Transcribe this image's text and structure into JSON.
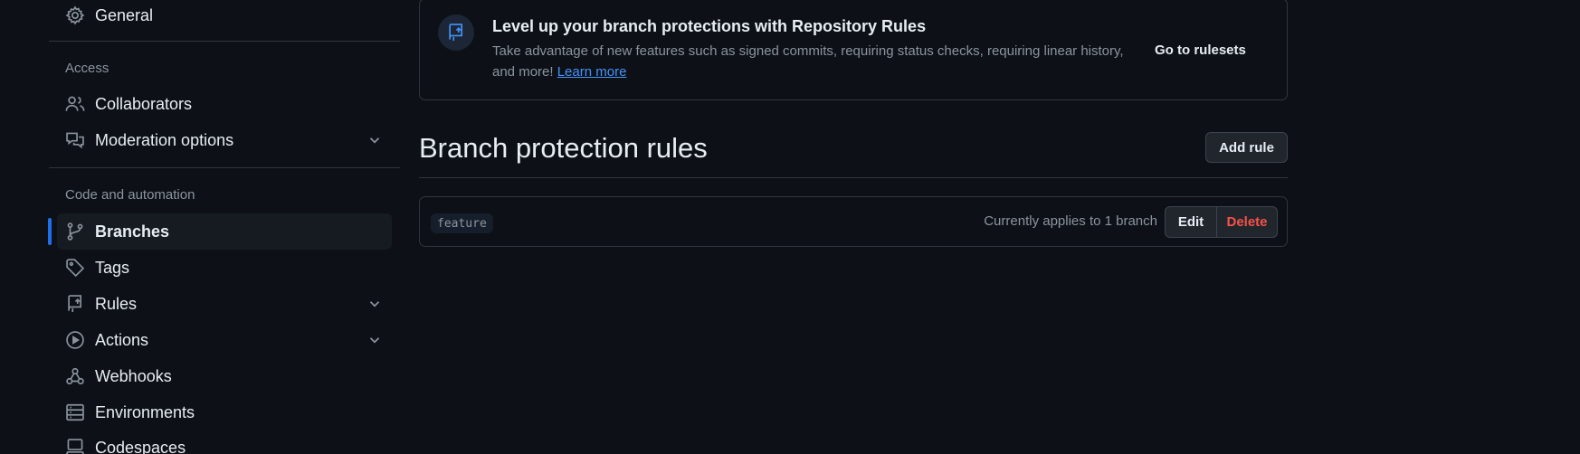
{
  "sidebar": {
    "items": [
      {
        "label": "General",
        "icon": "gear-icon"
      },
      {
        "label": "Collaborators",
        "icon": "people-icon"
      },
      {
        "label": "Moderation options",
        "icon": "comment-discussion-icon",
        "expandable": true
      },
      {
        "label": "Branches",
        "icon": "git-branch-icon",
        "active": true
      },
      {
        "label": "Tags",
        "icon": "tag-icon"
      },
      {
        "label": "Rules",
        "icon": "repo-push-icon",
        "expandable": true
      },
      {
        "label": "Actions",
        "icon": "play-icon",
        "expandable": true
      },
      {
        "label": "Webhooks",
        "icon": "webhook-icon"
      },
      {
        "label": "Environments",
        "icon": "server-icon"
      },
      {
        "label": "Codespaces",
        "icon": "codespaces-icon"
      }
    ],
    "headings": {
      "access": "Access",
      "code_automation": "Code and automation"
    }
  },
  "banner": {
    "title": "Level up your branch protections with Repository Rules",
    "description": "Take advantage of new features such as signed commits, requiring status checks, requiring linear history, and more!",
    "link": "Learn more",
    "cta": "Go to rulesets",
    "icon": "repo-push-icon"
  },
  "section": {
    "title": "Branch protection rules",
    "add_button": "Add rule"
  },
  "rules": [
    {
      "pattern": "feature",
      "applies": "Currently applies to 1 branch",
      "edit": "Edit",
      "delete": "Delete"
    }
  ],
  "colors": {
    "background": "#0d1117",
    "accent": "#1f6feb",
    "link": "#4493f8",
    "danger": "#f85149",
    "muted": "#8b949e"
  }
}
